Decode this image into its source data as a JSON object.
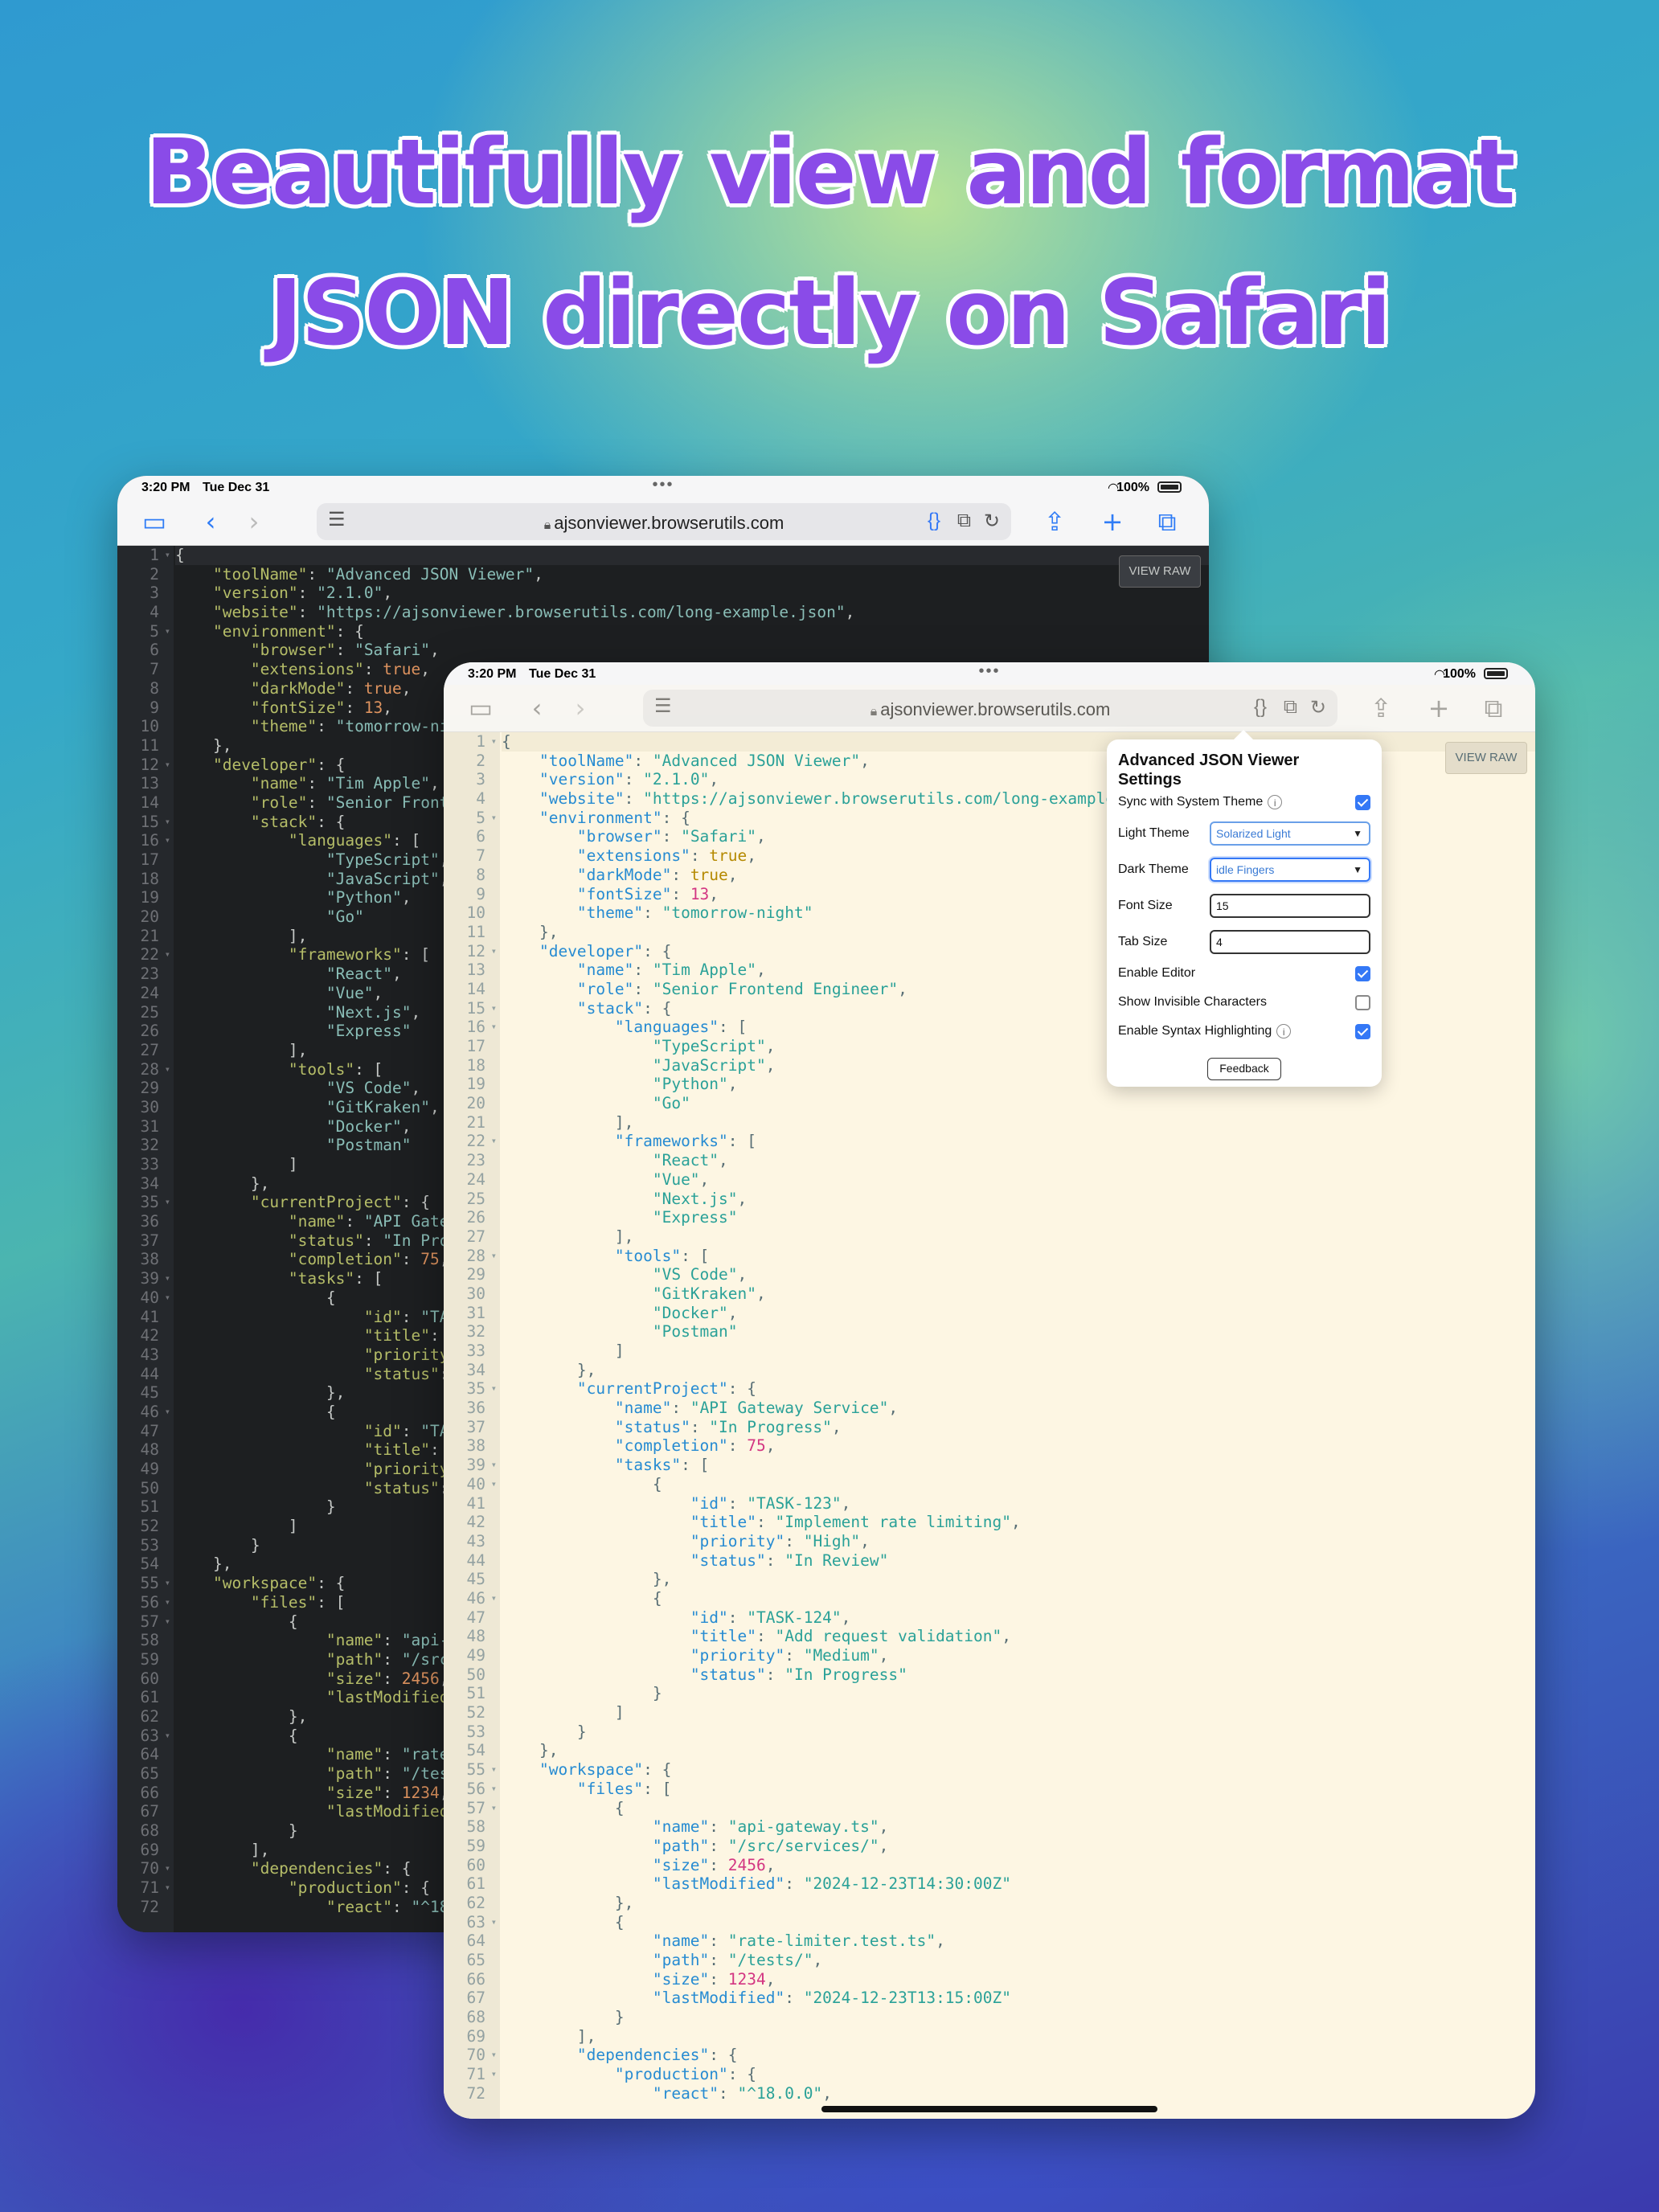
{
  "headline": {
    "line1": "Beautifully view and format",
    "line2": "JSON directly on Safari"
  },
  "status_bar": {
    "time": "3:20 PM",
    "date": "Tue Dec 31",
    "battery": "100%"
  },
  "browser": {
    "url": "ajsonviewer.browserutils.com",
    "view_raw_label": "VIEW RAW",
    "icons": [
      "sidebar-icon",
      "back-chevron-icon",
      "forward-chevron-icon",
      "page-menu-icon",
      "lock-icon",
      "json-extension-icon",
      "extension-icon",
      "reload-icon",
      "share-icon",
      "new-tab-plus-icon",
      "tabs-overview-icon"
    ]
  },
  "themes": {
    "back_dark": {
      "background": "#1d1f21",
      "key": "#b5bd68",
      "string": "#8abeb7",
      "number": "#de935f"
    },
    "front_light": {
      "background": "#fdf6e3",
      "key": "#268bd2",
      "string": "#2aa198",
      "number": "#d33682"
    }
  },
  "code_lines": [
    "{",
    "    \"toolName\": \"Advanced JSON Viewer\",",
    "    \"version\": \"2.1.0\",",
    "    \"website\": \"https://ajsonviewer.browserutils.com/long-example.json\",",
    "    \"environment\": {",
    "        \"browser\": \"Safari\",",
    "        \"extensions\": true,",
    "        \"darkMode\": true,",
    "        \"fontSize\": 13,",
    "        \"theme\": \"tomorrow-night\"",
    "    },",
    "    \"developer\": {",
    "        \"name\": \"Tim Apple\",",
    "        \"role\": \"Senior Frontend Engineer\",",
    "        \"stack\": {",
    "            \"languages\": [",
    "                \"TypeScript\",",
    "                \"JavaScript\",",
    "                \"Python\",",
    "                \"Go\"",
    "            ],",
    "            \"frameworks\": [",
    "                \"React\",",
    "                \"Vue\",",
    "                \"Next.js\",",
    "                \"Express\"",
    "            ],",
    "            \"tools\": [",
    "                \"VS Code\",",
    "                \"GitKraken\",",
    "                \"Docker\",",
    "                \"Postman\"",
    "            ]",
    "        },",
    "        \"currentProject\": {",
    "            \"name\": \"API Gateway Service\",",
    "            \"status\": \"In Progress\",",
    "            \"completion\": 75,",
    "            \"tasks\": [",
    "                {",
    "                    \"id\": \"TASK-123\",",
    "                    \"title\": \"Implement rate limiting\",",
    "                    \"priority\": \"High\",",
    "                    \"status\": \"In Review\"",
    "                },",
    "                {",
    "                    \"id\": \"TASK-124\",",
    "                    \"title\": \"Add request validation\",",
    "                    \"priority\": \"Medium\",",
    "                    \"status\": \"In Progress\"",
    "                }",
    "            ]",
    "        }",
    "    },",
    "    \"workspace\": {",
    "        \"files\": [",
    "            {",
    "                \"name\": \"api-gateway.ts\",",
    "                \"path\": \"/src/services/\",",
    "                \"size\": 2456,",
    "                \"lastModified\": \"2024-12-23T14:30:00Z\"",
    "            },",
    "            {",
    "                \"name\": \"rate-limiter.test.ts\",",
    "                \"path\": \"/tests/\",",
    "                \"size\": 1234,",
    "                \"lastModified\": \"2024-12-23T13:15:00Z\"",
    "            }",
    "        ],",
    "        \"dependencies\": {",
    "            \"production\": {",
    "                \"react\": \"^18.0.0\","
  ],
  "fold_lines": [
    1,
    5,
    12,
    15,
    16,
    22,
    28,
    35,
    39,
    40,
    46,
    55,
    56,
    57,
    63,
    70,
    71
  ],
  "settings_popover": {
    "title": "Advanced JSON Viewer Settings",
    "rows": [
      {
        "label": "Sync with System Theme",
        "type": "checkbox",
        "checked": true,
        "info": true
      },
      {
        "label": "Light Theme",
        "type": "select",
        "value": "Solarized Light"
      },
      {
        "label": "Dark Theme",
        "type": "select",
        "value": "idle Fingers"
      },
      {
        "label": "Font Size",
        "type": "text",
        "value": "15"
      },
      {
        "label": "Tab Size",
        "type": "text",
        "value": "4"
      },
      {
        "label": "Enable Editor",
        "type": "checkbox",
        "checked": true
      },
      {
        "label": "Show Invisible Characters",
        "type": "checkbox",
        "checked": false
      },
      {
        "label": "Enable Syntax Highlighting",
        "type": "checkbox",
        "checked": true,
        "info": true
      }
    ],
    "feedback_label": "Feedback"
  }
}
